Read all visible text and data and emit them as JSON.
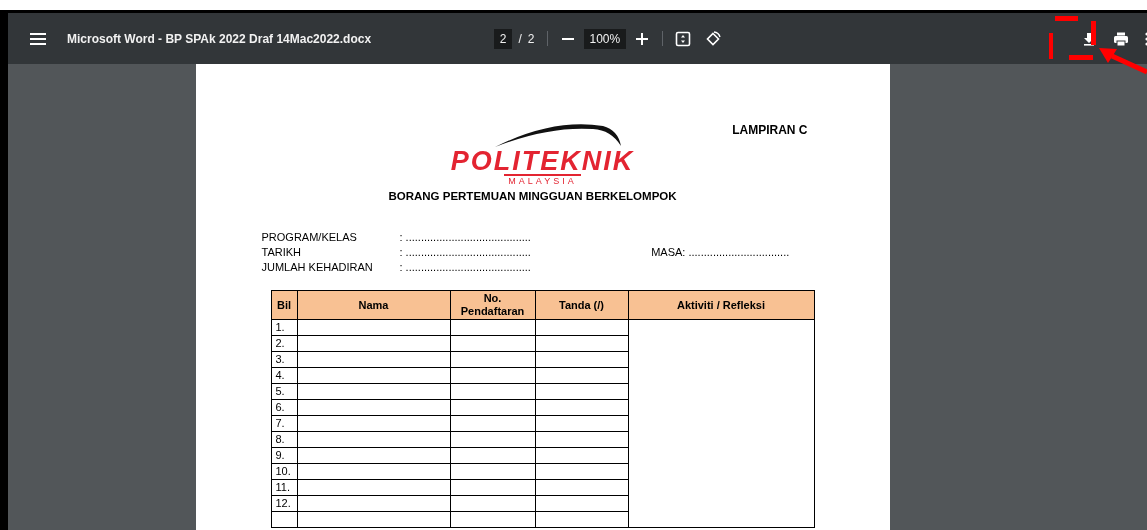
{
  "toolbar": {
    "title": "Microsoft Word - BP SPAk 2022 Draf 14Mac2022.docx",
    "page_current": "2",
    "page_separator": "/",
    "page_total": "2",
    "zoom": "100%"
  },
  "document": {
    "corner_label": "LAMPIRAN C",
    "logo": {
      "name": "POLITEKNIK",
      "subtitle": "MALAYSIA"
    },
    "heading": "BORANG PERTEMUAN MINGGUAN BERKELOMPOK",
    "fields": [
      {
        "label": "PROGRAM/KELAS",
        "value": ": ........................................."
      },
      {
        "label": "TARIKH",
        "value": ": .........................................",
        "side": "MASA: ................................."
      },
      {
        "label": "JUMLAH KEHADIRAN",
        "value": ": ........................................."
      }
    ],
    "table": {
      "columns": [
        "Bil",
        "Nama",
        "No. Pendaftaran",
        "Tanda (/)",
        "Aktiviti / Refleksi"
      ],
      "rows": [
        "1.",
        "2.",
        "3.",
        "4.",
        "5.",
        "6.",
        "7.",
        "8.",
        "9.",
        "10.",
        "11.",
        "12."
      ]
    }
  }
}
